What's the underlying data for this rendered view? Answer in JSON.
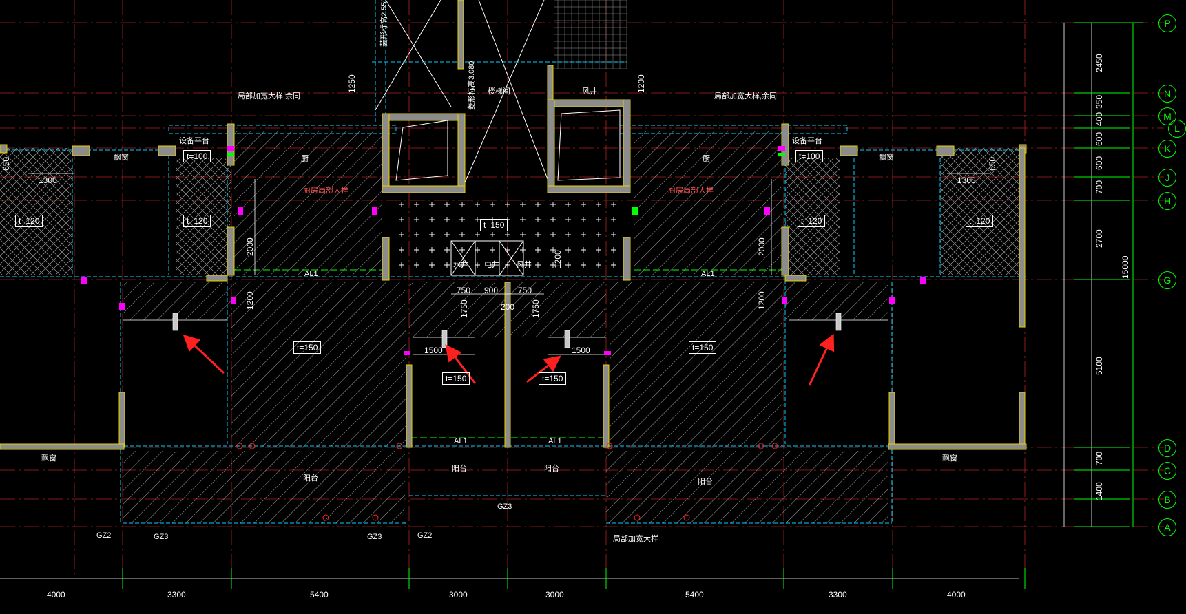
{
  "colors": {
    "background": "#000000",
    "axis_line": "#b22222",
    "dimension": "#00ff00",
    "beam_dashed": "#00d2ff",
    "wall": "#8c8c8c",
    "wall_edge": "#e6d200",
    "hatch": "#ffffff",
    "arrow": "#ff2020",
    "note_red": "#ff5555",
    "magenta": "#ff00ff"
  },
  "grid_axes_right": [
    {
      "label": "P"
    },
    {
      "label": "N"
    },
    {
      "label": "M"
    },
    {
      "label": "L"
    },
    {
      "label": "K"
    },
    {
      "label": "J"
    },
    {
      "label": "H"
    },
    {
      "label": "G"
    },
    {
      "label": "D"
    },
    {
      "label": "C"
    },
    {
      "label": "B"
    },
    {
      "label": "A"
    }
  ],
  "right_dimensions": [
    "2450",
    "350",
    "400",
    "600",
    "600",
    "700",
    "2700",
    "15000",
    "5100",
    "700",
    "1400"
  ],
  "bottom_dimensions": [
    "4000",
    "3300",
    "5400",
    "3000",
    "3000",
    "5400",
    "3300",
    "4000"
  ],
  "slabs": {
    "t120_a": "t=120",
    "t120_b": "t=120",
    "t120_c": "t=120",
    "t120_d": "t=120",
    "t100_a": "t=100",
    "t100_b": "t=100",
    "t150_core": "t=150",
    "t150_left": "t=150",
    "t150_right": "t=150",
    "t150_cl": "t=150",
    "t150_cr": "t=150"
  },
  "beams": {
    "al1_1": "AL1",
    "al1_2": "AL1",
    "al1_3": "AL1",
    "al1_4": "AL1"
  },
  "columns": {
    "gz2_l": "GZ2",
    "gz3_l": "GZ3",
    "gz3_m": "GZ3",
    "gz2_m": "GZ2",
    "gz3_c": "GZ3"
  },
  "dims_inner": {
    "d650_l": "650",
    "d1300_l": "1300",
    "d650_r": "650",
    "d1300_r": "1300",
    "d2000_l": "2000",
    "d1200_l": "1200",
    "d2000_r": "2000",
    "d1200_r": "1200",
    "d750_a": "750",
    "d900": "900",
    "d750_b": "750",
    "d200": "200",
    "d1750_a": "1750",
    "d1750_b": "1750",
    "d1500_a": "1500",
    "d1500_b": "1500",
    "d1250": "1250",
    "d1200_top": "1200",
    "d1200_core": "1200"
  },
  "room_labels": {
    "bay_win_l": "飘窗",
    "bay_win_r": "飘窗",
    "bay_win_bl": "飘窗",
    "bay_win_br": "飘窗",
    "equip_l": "设备平台",
    "equip_r": "设备平台",
    "kitchen_l": "厨",
    "kitchen_r": "厨",
    "balcony_l": "阳台",
    "balcony_cl": "阳台",
    "balcony_cr": "阳台",
    "balcony_r": "阳台",
    "shaft_a": "水井",
    "shaft_b": "电井",
    "shaft_c": "风井",
    "shaft_top": "风井",
    "stairs": "楼梯间"
  },
  "notes": {
    "local_widen_l": "局部加宽大样,余同",
    "local_widen_r": "局部加宽大样,余同",
    "kitchen_beam_l": "厨房局部大样",
    "kitchen_beam_r": "厨房局部大样",
    "local_widen_b": "局部加宽大样",
    "elev_a": "菱形标高2.550",
    "elev_b": "菱形标高3.080"
  }
}
